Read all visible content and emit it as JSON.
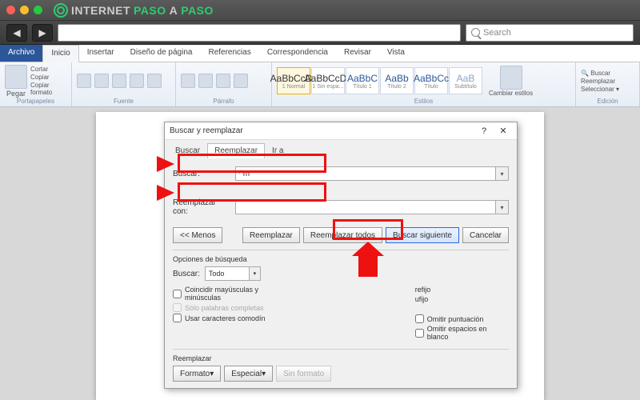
{
  "browser": {
    "brand_pre": "INTERNET",
    "brand_mid": "PASO",
    "brand_join": "A",
    "brand_post": "PASO",
    "search_placeholder": "Search"
  },
  "ribbon": {
    "tabs": {
      "file": "Archivo",
      "home": "Inicio",
      "insert": "Insertar",
      "layout": "Diseño de página",
      "references": "Referencias",
      "mail": "Correspondencia",
      "review": "Revisar",
      "view": "Vista"
    },
    "groups": {
      "clipboard": "Portapapeles",
      "font": "Fuente",
      "paragraph": "Párrafo",
      "styles": "Estilos",
      "editing": "Edición"
    },
    "clipboard": {
      "paste": "Pegar",
      "cut": "Cortar",
      "copy": "Copiar",
      "format": "Copiar formato"
    },
    "style_items": [
      "1 Normal",
      "1 Sin espa...",
      "Título 1",
      "Título 2",
      "Título",
      "Subtítulo"
    ],
    "style_sample": [
      "AaBbCcDc",
      "AaBbCcDc",
      "AaBbC",
      "AaBb",
      "AaBbCc",
      "AaB",
      "AaBbCc",
      "AaBbCc"
    ],
    "change_styles": "Cambiar estilos",
    "editing_items": {
      "find": "Buscar",
      "replace": "Reemplazar",
      "select": "Seleccionar"
    }
  },
  "dialog": {
    "title": "Buscar y reemplazar",
    "tabs": {
      "find": "Buscar",
      "replace": "Reemplazar",
      "goto": "Ir a"
    },
    "find_label": "Buscar:",
    "find_value": "^m",
    "replace_label": "Reemplazar con:",
    "replace_value": "",
    "less_btn": "<< Menos",
    "replace_btn": "Reemplazar",
    "replace_all_btn": "Reemplazar todos",
    "find_next_btn": "Buscar siguiente",
    "cancel_btn": "Cancelar",
    "options_title": "Opciones de búsqueda",
    "search_dir_label": "Buscar:",
    "search_dir_value": "Todo",
    "chk_case": "Coincidir mayúsculas y minúsculas",
    "chk_whole": "Sólo palabras completas",
    "chk_wildcard": "Usar caracteres comodín",
    "chk_prefix": "refijo",
    "chk_suffix": "ufijo",
    "chk_punct": "Omitir puntuación",
    "chk_space": "Omitir espacios en blanco",
    "footer_title": "Reemplazar",
    "format_btn": "Formato",
    "special_btn": "Especial",
    "noformat_btn": "Sin formato"
  }
}
